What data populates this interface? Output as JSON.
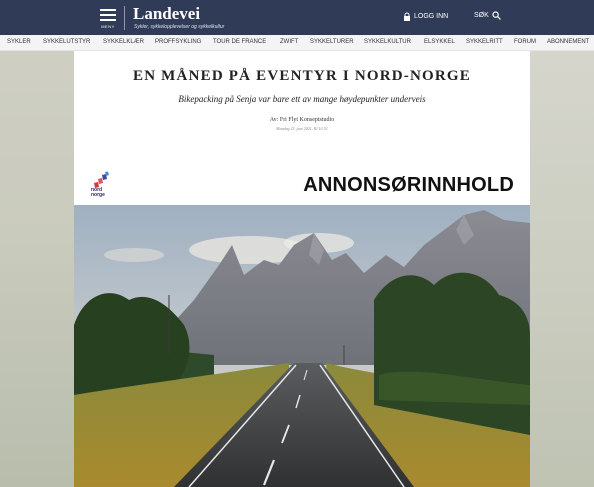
{
  "header": {
    "menu_label": "MENY",
    "logo": "Landevei",
    "tagline": "Sykler, sykkelopplevelser og sykkelkultur",
    "login_label": "LOGG INN",
    "search_label": "SØK"
  },
  "nav": {
    "items": [
      "SYKLER",
      "SYKKELUTSTYR",
      "SYKKELKLÆR",
      "PROFFSYKLING",
      "TOUR DE FRANCE",
      "ZWIFT",
      "SYKKELTURER",
      "SYKKELKULTUR",
      "ELSYKKEL",
      "SYKKELRITT",
      "FORUM",
      "ABONNEMENT"
    ]
  },
  "article": {
    "title": "EN MÅNED PÅ EVENTYR I NORD-NORGE",
    "subtitle": "Bikepacking på Senja var bare ett av mange høydepunkter underveis",
    "byline": "Av: Fri Flyt Konseptstudio",
    "date": "Mandag 21. juni 2021. Kl 10:51"
  },
  "sponsor": {
    "brand": "nord\nnorge",
    "label": "ANNONSØRINNHOLD"
  },
  "colors": {
    "header_bg": "#2f3b57",
    "nav_bg": "#f4f4f4",
    "brand_red": "#e0343a",
    "brand_blue": "#3e4ba3"
  },
  "icons": {
    "menu": "hamburger-menu-icon",
    "login": "lock-icon",
    "search": "search-icon"
  }
}
